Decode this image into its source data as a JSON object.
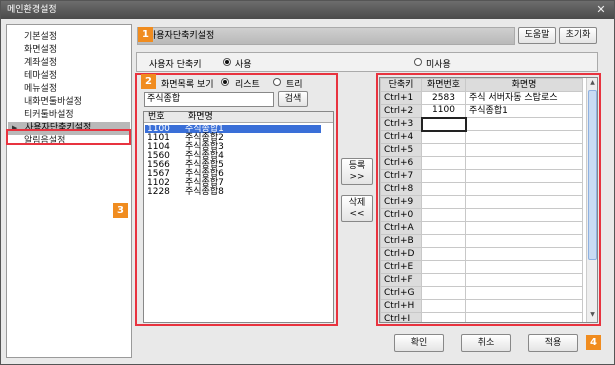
{
  "window": {
    "title": "메인환경설정",
    "close_glyph": "✕"
  },
  "sidebar": {
    "items": [
      {
        "label": "기본설정",
        "active": false
      },
      {
        "label": "화면설정",
        "active": false
      },
      {
        "label": "계좌설정",
        "active": false
      },
      {
        "label": "테마설정",
        "active": false
      },
      {
        "label": "메뉴설정",
        "active": false
      },
      {
        "label": "내화면툴바설정",
        "active": false
      },
      {
        "label": "티커툴바설정",
        "active": false
      },
      {
        "label": "사용자단축키설정",
        "active": true
      },
      {
        "label": "알림음설정",
        "active": false
      }
    ],
    "active_arrow": "▶"
  },
  "header": {
    "title": "사용자단축키설정",
    "help_label": "도움말",
    "reset_label": "초기화"
  },
  "shortcut_toggle": {
    "label": "사용자 단축키",
    "option_use": "사용",
    "option_nouse": "미사용",
    "selected": "사용"
  },
  "screen_list": {
    "view_label": "화면목록 보기",
    "option_list": "리스트",
    "option_tree": "트리",
    "selected_view": "리스트",
    "search_value": "주식종합",
    "search_button": "검색",
    "col_number": "번호",
    "col_name": "화면명",
    "rows": [
      {
        "number": "1100",
        "name": "주식종합1",
        "selected": true
      },
      {
        "number": "1101",
        "name": "주식종합2",
        "selected": false
      },
      {
        "number": "1104",
        "name": "주식종합3",
        "selected": false
      },
      {
        "number": "1560",
        "name": "주식종합4",
        "selected": false
      },
      {
        "number": "1566",
        "name": "주식종합5",
        "selected": false
      },
      {
        "number": "1567",
        "name": "주식종합6",
        "selected": false
      },
      {
        "number": "1102",
        "name": "주식종합7",
        "selected": false
      },
      {
        "number": "1228",
        "name": "주식종합8",
        "selected": false
      }
    ]
  },
  "actions": {
    "register_label": "등록",
    "register_arrow": ">>",
    "delete_label": "삭제",
    "delete_arrow": "<<"
  },
  "shortcut_grid": {
    "col_key": "단축키",
    "col_code": "화면번호",
    "col_name": "화면명",
    "rows": [
      {
        "key": "Ctrl+1",
        "code": "2583",
        "name": "주식 서버자동 스탑로스"
      },
      {
        "key": "Ctrl+2",
        "code": "1100",
        "name": "주식종합1"
      },
      {
        "key": "Ctrl+3",
        "code": "",
        "name": ""
      },
      {
        "key": "Ctrl+4",
        "code": "",
        "name": ""
      },
      {
        "key": "Ctrl+5",
        "code": "",
        "name": ""
      },
      {
        "key": "Ctrl+6",
        "code": "",
        "name": ""
      },
      {
        "key": "Ctrl+7",
        "code": "",
        "name": ""
      },
      {
        "key": "Ctrl+8",
        "code": "",
        "name": ""
      },
      {
        "key": "Ctrl+9",
        "code": "",
        "name": ""
      },
      {
        "key": "Ctrl+0",
        "code": "",
        "name": ""
      },
      {
        "key": "Ctrl+A",
        "code": "",
        "name": ""
      },
      {
        "key": "Ctrl+B",
        "code": "",
        "name": ""
      },
      {
        "key": "Ctrl+D",
        "code": "",
        "name": ""
      },
      {
        "key": "Ctrl+E",
        "code": "",
        "name": ""
      },
      {
        "key": "Ctrl+F",
        "code": "",
        "name": ""
      },
      {
        "key": "Ctrl+G",
        "code": "",
        "name": ""
      },
      {
        "key": "Ctrl+H",
        "code": "",
        "name": ""
      },
      {
        "key": "Ctrl+I",
        "code": "",
        "name": ""
      }
    ]
  },
  "footer": {
    "ok_label": "확인",
    "cancel_label": "취소",
    "apply_label": "적용"
  },
  "badges": {
    "b1": "1",
    "b2": "2",
    "b3": "3",
    "b4": "4"
  },
  "colors": {
    "callout_red": "#e8333f",
    "badge_orange": "#f08c1f",
    "selection_blue": "#3a6fd8"
  }
}
